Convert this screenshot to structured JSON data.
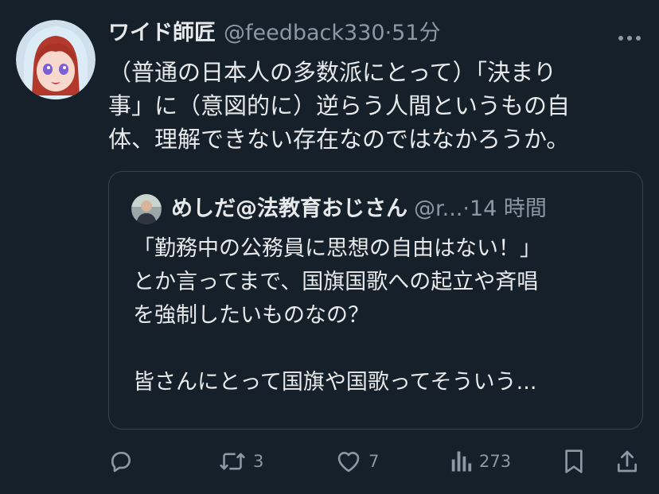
{
  "tweet": {
    "display_name": "ワイド師匠",
    "handle": "@feedback330",
    "separator": "·",
    "time": "51分",
    "more_icon": "more-dots-icon",
    "text_lines": [
      "（普通の日本人の多数派にとって）「決まり",
      "事」に（意図的に）逆らう人間というもの自",
      "体、理解できない存在なのではなかろうか。"
    ]
  },
  "quote": {
    "display_name": "めしだ@法教育おじさん",
    "handle": "@r...",
    "separator": "·",
    "time": "14 時間",
    "text_lines": [
      "「勤務中の公務員に思想の自由はない！」",
      "とか言ってまで、国旗国歌への起立や斉唱",
      "を強制したいものなの？",
      "",
      "皆さんにとって国旗や国歌ってそういう..."
    ]
  },
  "actions": {
    "reply": {
      "icon": "reply-icon"
    },
    "retweet": {
      "icon": "retweet-icon",
      "count": "3"
    },
    "like": {
      "icon": "heart-icon",
      "count": "7"
    },
    "views": {
      "icon": "views-icon",
      "count": "273"
    },
    "bookmark": {
      "icon": "bookmark-icon"
    },
    "share": {
      "icon": "share-icon"
    }
  },
  "colors": {
    "background": "#15202b",
    "text": "#e7e9ea",
    "secondary": "#8b98a5",
    "border": "#38444d"
  }
}
